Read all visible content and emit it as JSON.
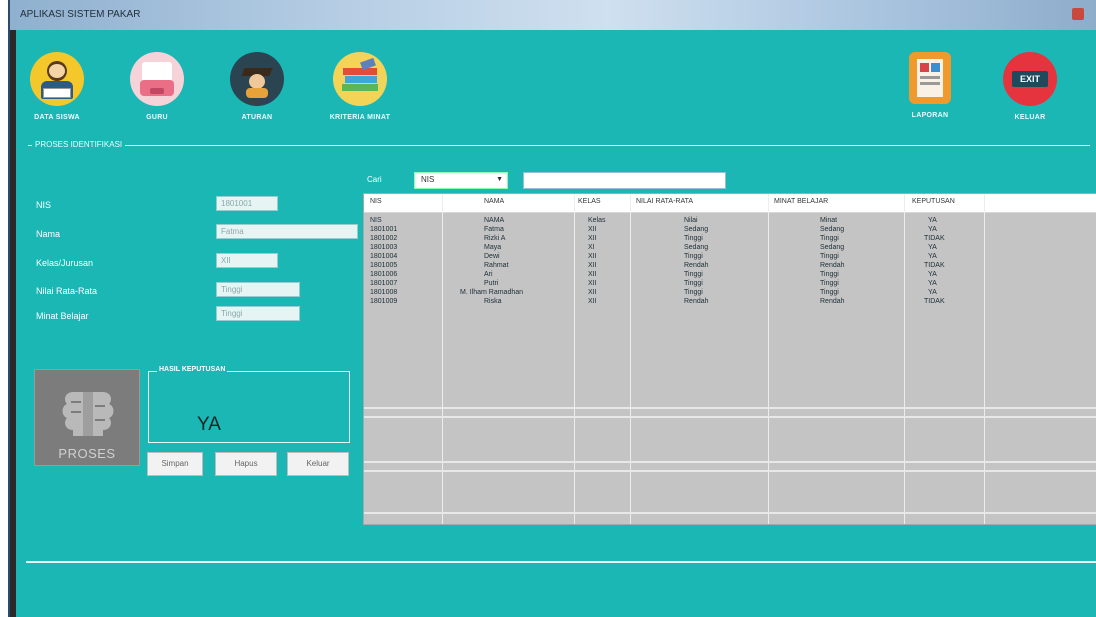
{
  "window": {
    "title": "APLIKASI SISTEM PAKAR"
  },
  "toolbar": {
    "items": [
      {
        "label": "DATA SISWA",
        "icon": "student-reading-icon"
      },
      {
        "label": "GURU",
        "icon": "teacher-icon"
      },
      {
        "label": "ATURAN",
        "icon": "graduate-icon"
      },
      {
        "label": "KRITERIA MINAT",
        "icon": "books-icon"
      }
    ],
    "right_items": [
      {
        "label": "LAPORAN",
        "icon": "report-icon"
      },
      {
        "label": "KELUAR",
        "icon": "exit-icon"
      }
    ],
    "exit_badge": "EXIT"
  },
  "form": {
    "group_title": "PROSES IDENTIFIKASI",
    "fields": [
      {
        "label": "NIS",
        "value": "1801001"
      },
      {
        "label": "Nama",
        "value": "Fatma"
      },
      {
        "label": "Kelas/Jurusan",
        "value": "XII"
      },
      {
        "label": "Nilai Rata-Rata",
        "value": "Tinggi"
      },
      {
        "label": "Minat Belajar",
        "value": "Tinggi"
      }
    ],
    "proses_label": "PROSES",
    "result_title": "HASIL KEPUTUSAN",
    "result_value": "YA",
    "buttons": [
      "Simpan",
      "Hapus",
      "Keluar"
    ]
  },
  "table": {
    "filter_label": "Cari",
    "filter_value": "NIS",
    "columns": [
      "NIS",
      "NAMA",
      "KELAS",
      "NILAI RATA-RATA",
      "MINAT BELAJAR",
      "KEPUTUSAN"
    ],
    "rows": [
      [
        "NIS",
        "NAMA",
        "Kelas",
        "Nilai",
        "Minat",
        "YA"
      ],
      [
        "1801001",
        "Fatma",
        "XII",
        "Sedang",
        "Sedang",
        "YA"
      ],
      [
        "1801002",
        "Rizki A",
        "XII",
        "Tinggi",
        "Tinggi",
        "TIDAK"
      ],
      [
        "1801003",
        "Maya",
        "XI",
        "Sedang",
        "Sedang",
        "YA"
      ],
      [
        "1801004",
        "Dewi",
        "XII",
        "Tinggi",
        "Tinggi",
        "YA"
      ],
      [
        "1801005",
        "Rahmat",
        "XII",
        "Rendah",
        "Rendah",
        "TIDAK"
      ],
      [
        "1801006",
        "Ari",
        "XII",
        "Tinggi",
        "Tinggi",
        "YA"
      ],
      [
        "1801007",
        "Putri",
        "XII",
        "Tinggi",
        "Tinggi",
        "YA"
      ],
      [
        "1801008",
        "M. Ilham Ramadhan",
        "XII",
        "Tinggi",
        "Tinggi",
        "YA"
      ],
      [
        "1801009",
        "Riska",
        "XII",
        "Rendah",
        "Rendah",
        "TIDAK"
      ]
    ]
  },
  "colors": {
    "background": "#1ab7b5",
    "grid": "#c4c4c4",
    "proses": "#7c7c7c"
  }
}
